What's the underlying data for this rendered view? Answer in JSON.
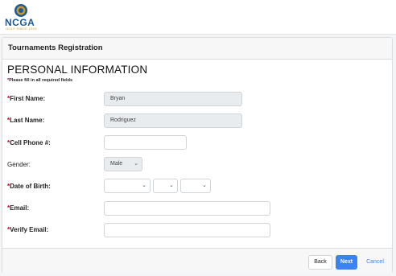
{
  "brand": {
    "name": "NCGA",
    "tagline": "GOLF SINCE 1903"
  },
  "page": {
    "title": "Tournaments Registration",
    "section_title": "PERSONAL INFORMATION",
    "required_note_star": "*",
    "required_note": "Please fill in all required fields"
  },
  "form": {
    "first_name": {
      "star": "*",
      "label": "First Name:",
      "value": "Bryan"
    },
    "last_name": {
      "star": "*",
      "label": "Last Name:",
      "value": "Rodriguez"
    },
    "cell_phone": {
      "star": "*",
      "label": "Cell Phone #:",
      "value": ""
    },
    "gender": {
      "label": "Gender:",
      "value": "Male"
    },
    "dob": {
      "star": "*",
      "label": "Date of Birth:",
      "month": "",
      "day": "",
      "year": ""
    },
    "email": {
      "star": "*",
      "label": "Email:",
      "value": ""
    },
    "verify_email": {
      "star": "*",
      "label": "Verify Email:",
      "value": ""
    }
  },
  "footer": {
    "back_label": "Back",
    "next_label": "Next",
    "cancel_label": "Cancel"
  },
  "icons": {
    "chevron": "chevron-down-icon"
  },
  "colors": {
    "primary": "#3b82f6",
    "required": "#d0021b",
    "brand_blue": "#1b5a9a",
    "brand_gold": "#c79b2a"
  }
}
